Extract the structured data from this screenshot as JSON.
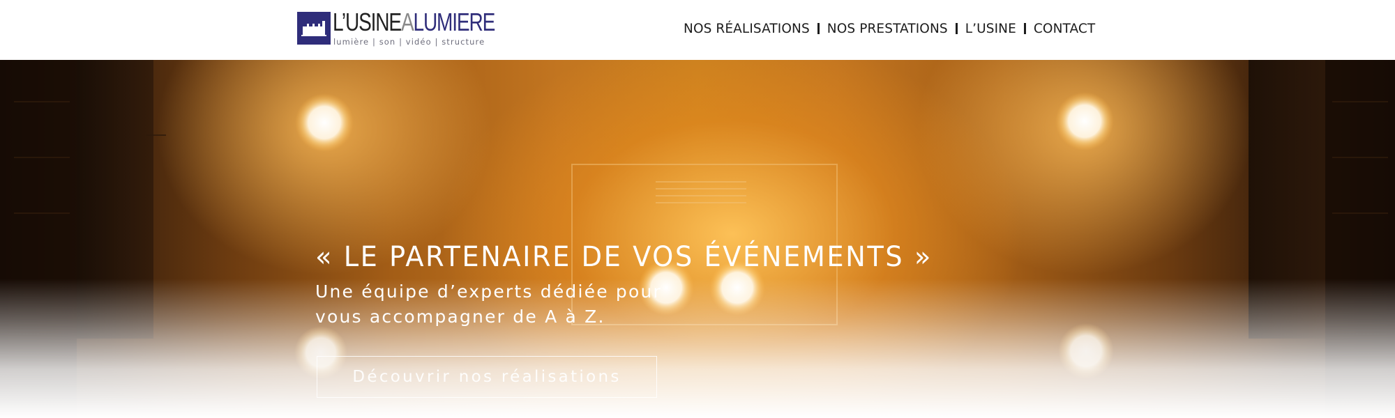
{
  "brand": {
    "logo_word_part1": "L’USINE",
    "logo_word_part2": "A",
    "logo_word_part3": "LUMIERE",
    "tagline": "lumière | son | vidéo | structure",
    "icon": "factory-icon",
    "colors": {
      "primary": "#2f2d7a",
      "dark": "#222222",
      "grey": "#8a8a8a"
    }
  },
  "nav": {
    "items": [
      {
        "label": "NOS RÉALISATIONS"
      },
      {
        "label": "NOS PRESTATIONS"
      },
      {
        "label": "L’USINE"
      },
      {
        "label": "CONTACT"
      }
    ]
  },
  "hero": {
    "title": "« LE PARTENAIRE DE VOS ÉVÉNEMENTS »",
    "subtitle_line1": "Une équipe d’experts dédiée pour",
    "subtitle_line2": "vous accompagner de A à Z.",
    "cta_label": "Découvrir nos réalisations",
    "colors": {
      "glow": "#c9801f",
      "text": "#ffffff"
    }
  }
}
